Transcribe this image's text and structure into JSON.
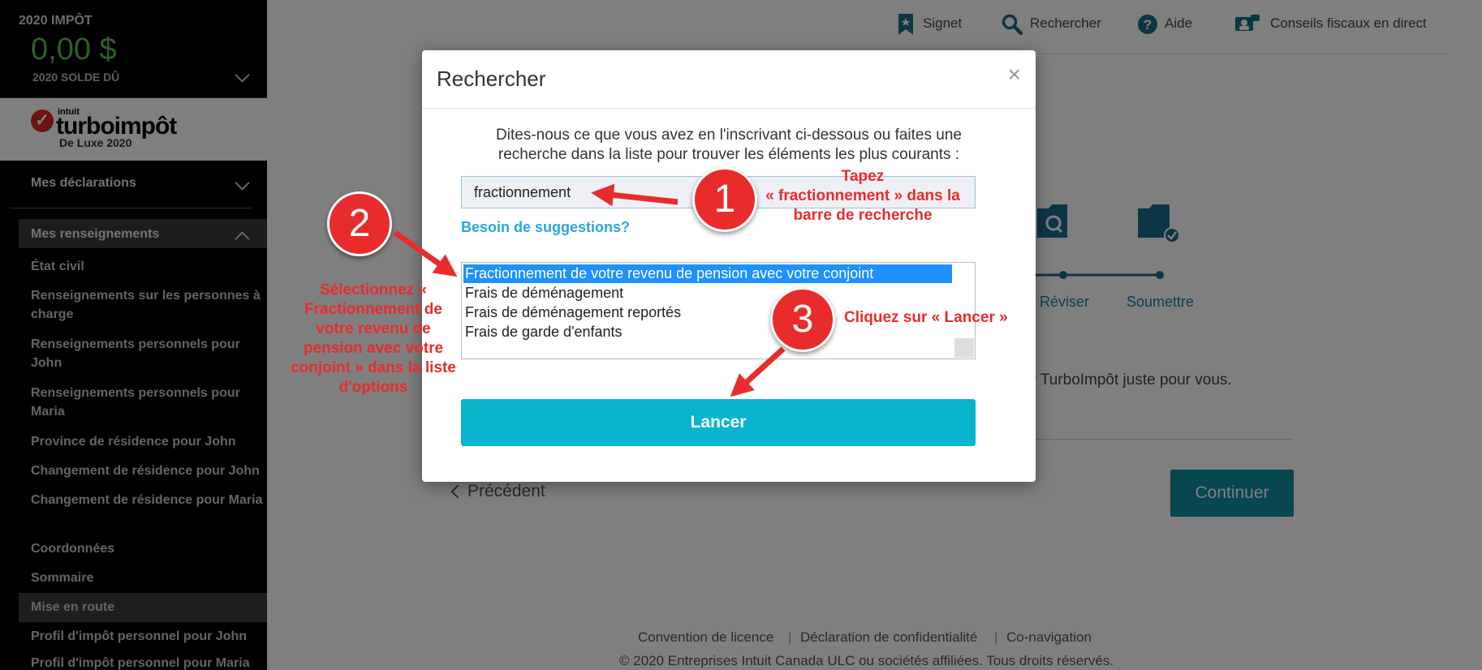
{
  "sidebar": {
    "tax_year": "2020 IMPÔT",
    "amount": "0,00 $",
    "balance_label": "2020 SOLDE DÛ",
    "logo": {
      "intuit": "intuit",
      "name": "turboimpôt",
      "edition": "De Luxe 2020"
    },
    "sections": [
      {
        "label": "Mes déclarations"
      },
      {
        "label": "Mes renseignements"
      }
    ],
    "items": [
      "État civil",
      "Renseignements sur les personnes à charge",
      "Renseignements personnels pour John",
      "Renseignements personnels pour Maria",
      "Province de résidence pour John",
      "Changement de résidence pour John",
      "Changement de résidence pour Maria",
      "Coordonnées",
      "Sommaire",
      "Mise en route",
      "Profil d'impôt personnel pour John",
      "Profil d'impôt personnel pour Maria"
    ]
  },
  "topbar": {
    "bookmark": "Signet",
    "search": "Rechercher",
    "help": "Aide",
    "live": "Conseils fiscaux en direct"
  },
  "background": {
    "steps": [
      "Réviser",
      "Soumettre"
    ],
    "text_fragment": "er TurboImpôt juste pour vous.",
    "previous": "Précédent",
    "continue": "Continuer",
    "footer_links": [
      "Convention de licence",
      "Déclaration de confidentialité",
      "Co-navigation"
    ],
    "copyright": "© 2020 Entreprises Intuit Canada ULC ou sociétés affiliées. Tous droits réservés."
  },
  "modal": {
    "title": "Rechercher",
    "close": "×",
    "description": "Dites-nous ce que vous avez en l'inscrivant ci-dessous ou faites une recherche dans la liste pour trouver les éléments les plus courants :",
    "search_value": "fractionnement",
    "suggestions_link": "Besoin de suggestions?",
    "options": [
      "Fractionnement de votre revenu de pension avec votre conjoint",
      "Frais de déménagement",
      "Frais de déménagement reportés",
      "Frais de garde d'enfants"
    ],
    "selected_option": 0,
    "launch": "Lancer"
  },
  "annotations": {
    "step1": {
      "number": "1",
      "text": "Tapez\n« fractionnement » dans la barre de recherche"
    },
    "step2": {
      "number": "2",
      "text": "Sélectionnez « Fractionnement de votre revenu de pension avec votre conjoint » dans la liste d'options"
    },
    "step3": {
      "number": "3",
      "text": "Cliquez sur « Lancer »"
    }
  },
  "colors": {
    "accent": "#08b5cd",
    "annotation": "#e82c2c",
    "amount": "#5fbf4f",
    "selected": "#1e90ff"
  }
}
